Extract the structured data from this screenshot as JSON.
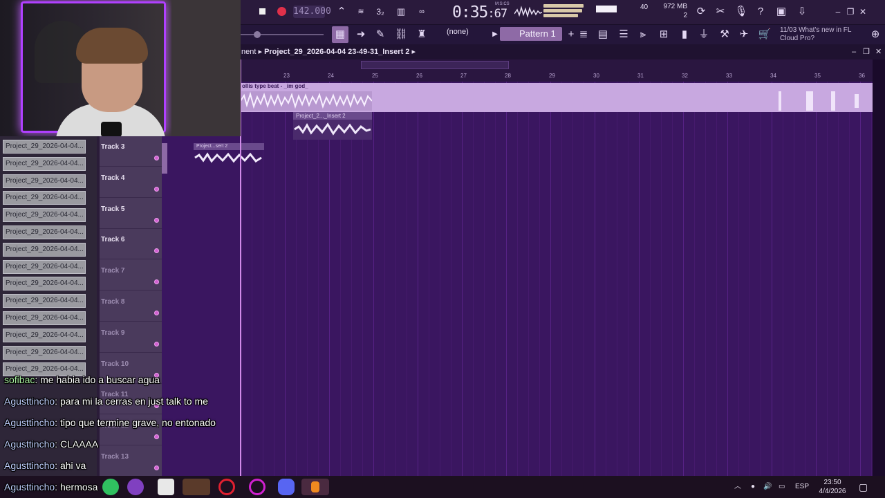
{
  "toolbar": {
    "tempo": "142.000",
    "time_main": "0:35",
    "time_small": ":67",
    "time_unit": "M:S:CS",
    "cpu_value": "40",
    "memory": "972 MB",
    "voices": "2",
    "pattern_label": "Pattern 1",
    "snap_label": "(none)",
    "news_date": "11/03",
    "news_text": "What's new in FL Cloud Pro?"
  },
  "breadcrumb": {
    "prefix": "nent",
    "project": "Project_29_2026-04-04 23-49-31_Insert 2"
  },
  "ruler": {
    "bars": [
      "23",
      "24",
      "25",
      "26",
      "27",
      "28",
      "29",
      "30",
      "31",
      "32",
      "33",
      "34",
      "35",
      "36"
    ]
  },
  "clips": {
    "main_label": "ollis type beat - _im god_",
    "insert_clip": "Project_2..._Insert 2",
    "mini_clip": "Project...sert 2"
  },
  "browser": {
    "items": [
      "Project_29_2026-04-04...",
      "Project_29_2026-04-04...",
      "Project_29_2026-04-04...",
      "Project_29_2026-04-04...",
      "Project_29_2026-04-04...",
      "Project_29_2026-04-04...",
      "Project_29_2026-04-04...",
      "Project_29_2026-04-04...",
      "Project_29_2026-04-04...",
      "Project_29_2026-04-04...",
      "Project_29_2026-04-04...",
      "Project_29_2026-04-04...",
      "Project_29_2026-04-04...",
      "Project_29_2026-04-04..."
    ]
  },
  "tracks": [
    {
      "name": "Track 3"
    },
    {
      "name": "Track 4"
    },
    {
      "name": "Track 5"
    },
    {
      "name": "Track 6"
    },
    {
      "name": "Track 7"
    },
    {
      "name": "Track 8"
    },
    {
      "name": "Track 9"
    },
    {
      "name": "Track 10"
    },
    {
      "name": "Track 11"
    },
    {
      "name": "Track 12"
    },
    {
      "name": "Track 13"
    }
  ],
  "chat": [
    {
      "user": "sofibac",
      "color": "#a8f0a0",
      "text": "me habia ido a buscar agua"
    },
    {
      "user": "Agusttincho",
      "color": "#c0d0ff",
      "text": "para mi la cerras en just talk to me"
    },
    {
      "user": "Agusttincho",
      "color": "#c0d0ff",
      "text": "tipo que termine grave, no entonado"
    },
    {
      "user": "Agusttincho",
      "color": "#c0d0ff",
      "text": "CLAAAA"
    },
    {
      "user": "Agusttincho",
      "color": "#c0d0ff",
      "text": "ahi va"
    },
    {
      "user": "Agusttincho",
      "color": "#c0d0ff",
      "text": "hermosa"
    }
  ],
  "taskbar": {
    "language": "ESP",
    "time": "23:50",
    "date": "4/4/2026"
  },
  "colors": {
    "playlist_bg": "#3a1660",
    "audio_clip": "#c8a8e0",
    "accent": "#b040ff"
  }
}
